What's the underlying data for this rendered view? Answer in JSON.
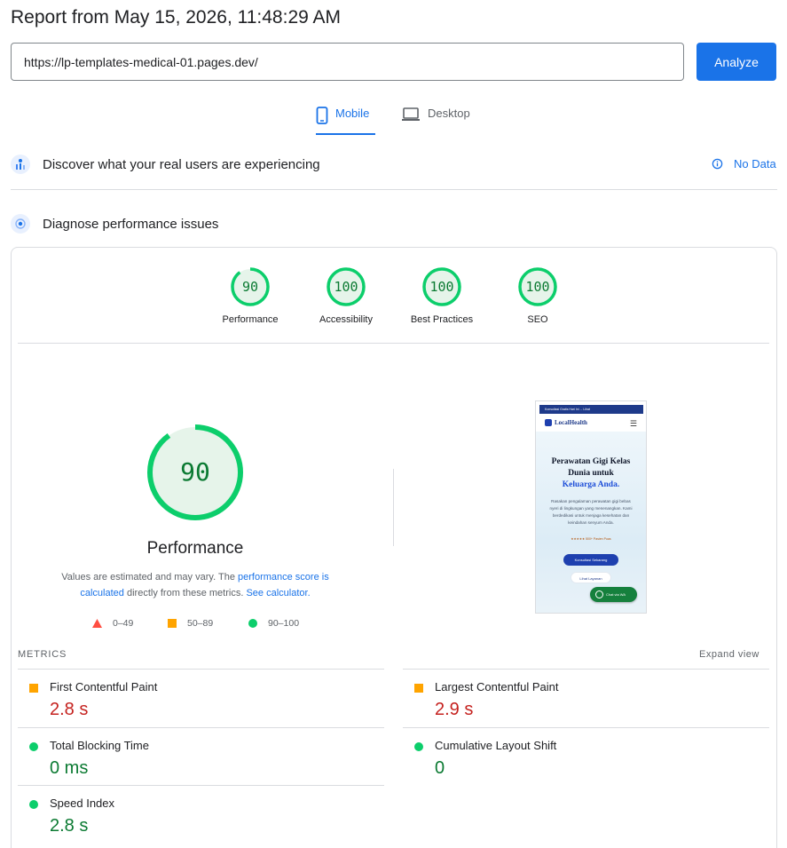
{
  "report": {
    "title": "Report from May 15, 2026, 11:48:29 AM"
  },
  "url_bar": {
    "value": "https://lp-templates-medical-01.pages.dev/",
    "analyze_label": "Analyze"
  },
  "tabs": [
    {
      "label": "Mobile",
      "active": true
    },
    {
      "label": "Desktop",
      "active": false
    }
  ],
  "field_data": {
    "title": "Discover what your real users are experiencing",
    "status": "No Data"
  },
  "diagnose": {
    "title": "Diagnose performance issues"
  },
  "categories": [
    {
      "label": "Performance",
      "score": "90"
    },
    {
      "label": "Accessibility",
      "score": "100"
    },
    {
      "label": "Best Practices",
      "score": "100"
    },
    {
      "label": "SEO",
      "score": "100"
    }
  ],
  "performance": {
    "score": "90",
    "title": "Performance",
    "desc_1": "Values are estimated and may vary. The ",
    "link_1": "performance score is calculated",
    "desc_2": " directly from these metrics. ",
    "link_2": "See calculator."
  },
  "legend": [
    {
      "range": "0–49",
      "color": "#ff4e42"
    },
    {
      "range": "50–89",
      "color": "#ffa400"
    },
    {
      "range": "90–100",
      "color": "#0cce6b"
    }
  ],
  "screenshot": {
    "topbar": "Konsultasi Gratis Hari Ini ... Lihat",
    "logo": "LocalHealth",
    "headline_1": "Perawatan Gigi Kelas",
    "headline_2": "Dunia untuk",
    "headline_3": "Keluarga Anda.",
    "body": "Rasakan pengalaman perawatan gigi bebas nyeri di lingkungan yang menenangkan. Kami berdedikasi untuk menjaga kesehatan dan keindahan senyum Anda.",
    "rating": "★★★★★ 500+ Pasien Puas",
    "cta_primary": "Konsultasi Sekarang",
    "cta_secondary": "Lihat Layanan",
    "chat": "Chat via WA"
  },
  "metrics": {
    "label": "METRICS",
    "expand": "Expand view",
    "items": [
      {
        "name": "First Contentful Paint",
        "value": "2.8 s",
        "status": "average"
      },
      {
        "name": "Largest Contentful Paint",
        "value": "2.9 s",
        "status": "average"
      },
      {
        "name": "Total Blocking Time",
        "value": "0 ms",
        "status": "good"
      },
      {
        "name": "Cumulative Layout Shift",
        "value": "0",
        "status": "good"
      },
      {
        "name": "Speed Index",
        "value": "2.8 s",
        "status": "good"
      }
    ]
  },
  "colors": {
    "accent": "#1a73e8",
    "good": "#0cce6b",
    "average": "#ffa400",
    "poor": "#ff4e42"
  }
}
